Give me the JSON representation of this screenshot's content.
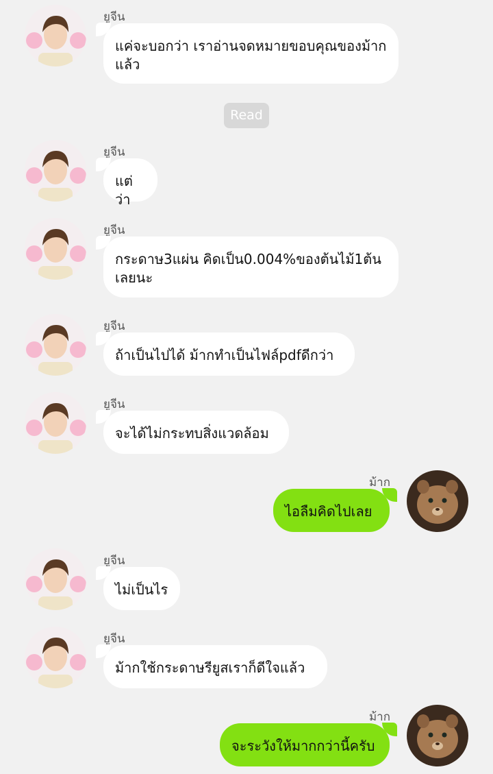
{
  "chat": {
    "contact_name": "ยูจีน",
    "self_name": "ม้าก",
    "read_label": "Read",
    "messages": [
      {
        "sender": "ยูจีน",
        "text": "แค่จะบอกว่า เราอ่านจดหมายขอบคุณของม้ากแล้ว"
      },
      {
        "sender": "ยูจีน",
        "text": "แต่ว่า"
      },
      {
        "sender": "ยูจีน",
        "text": "กระดาษ3แผ่น คิดเป็น0.004%ของต้นไม้1ต้นเลยนะ"
      },
      {
        "sender": "ยูจีน",
        "text": "ถ้าเป็นไปได้ ม้ากทำเป็นไฟล์pdfดีกว่า"
      },
      {
        "sender": "ยูจีน",
        "text": "จะได้ไม่กระทบสิ่งแวดล้อม"
      },
      {
        "sender": "ม้าก",
        "text": "ไอลืมคิดไปเลย"
      },
      {
        "sender": "ยูจีน",
        "text": "ไม่เป็นไร"
      },
      {
        "sender": "ยูจีน",
        "text": "ม้ากใช้กระดาษรียูสเราก็ดีใจแล้ว"
      },
      {
        "sender": "ม้าก",
        "text": "จะระวังให้มากกว่านี้ครับ"
      }
    ]
  },
  "colors": {
    "background": "#f1f1f1",
    "incoming_bubble": "#ffffff",
    "outgoing_bubble": "#83e012",
    "read_pill": "#d8d8d8"
  },
  "icons": {
    "contact_avatar": "person-photo-avatar",
    "self_avatar": "lion-cub-photo-avatar"
  }
}
